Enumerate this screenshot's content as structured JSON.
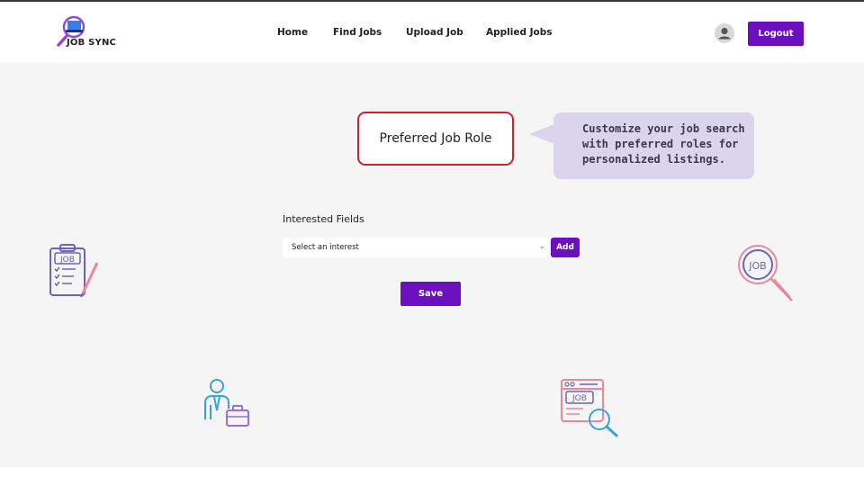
{
  "app": {
    "logo_text": "JOB SYNC"
  },
  "nav": {
    "items": [
      {
        "label": "Home"
      },
      {
        "label": "Find Jobs"
      },
      {
        "label": "Upload Job"
      },
      {
        "label": "Applied Jobs"
      }
    ],
    "logout_label": "Logout"
  },
  "main": {
    "preferred_role_label": "Preferred Job Role",
    "tooltip_text": "Customize your job search with preferred roles for personalized listings.",
    "interested_fields_label": "Interested Fields",
    "select_value": "Select an interest",
    "add_label": "Add",
    "save_label": "Save"
  },
  "decorations": {
    "clipboard_badge": "JOB",
    "magnifier_badge": "JOB",
    "browser_badge": "JOB"
  },
  "colors": {
    "accent": "#6c0fbf",
    "highlight_border": "#d0202a",
    "tooltip_bg": "#dcd4ec",
    "page_bg": "#f5f5f5"
  }
}
